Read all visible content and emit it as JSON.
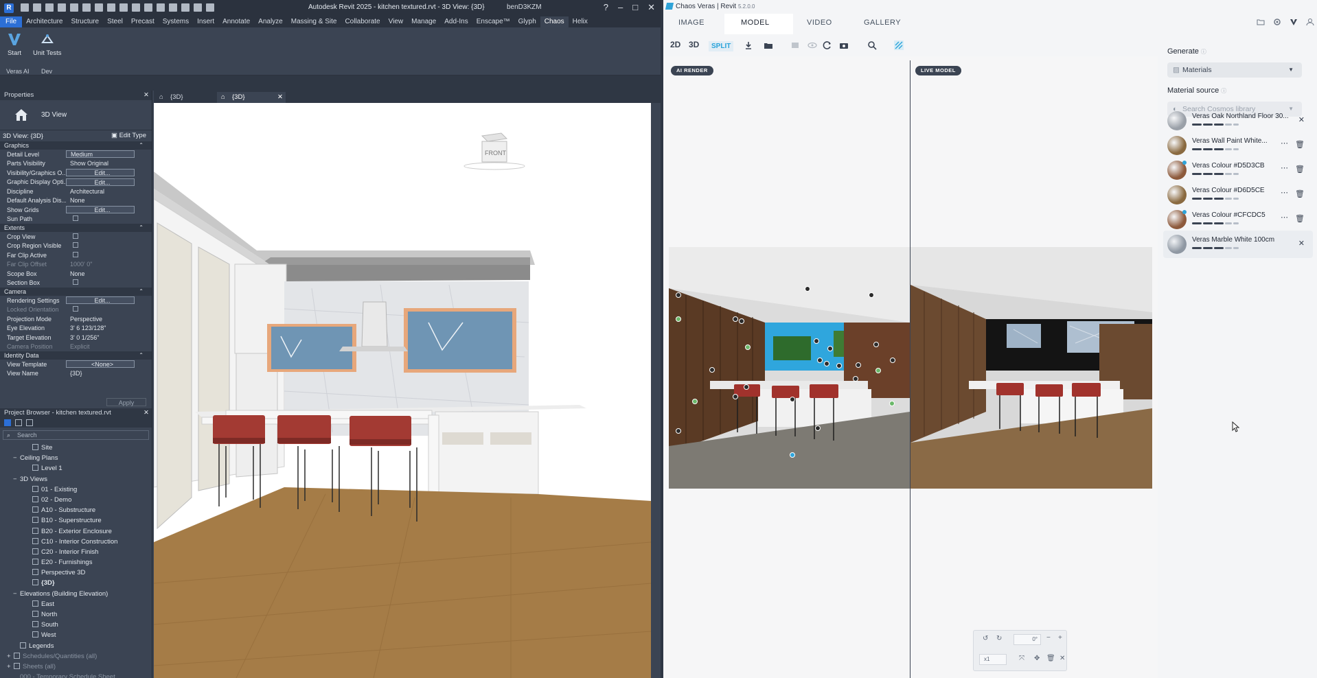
{
  "revit": {
    "window_title": "Autodesk Revit 2025 - kitchen textured.rvt - 3D View: {3D}",
    "user": "benD3KZM",
    "app_badge": "R",
    "menu": [
      "File",
      "Architecture",
      "Structure",
      "Steel",
      "Precast",
      "Systems",
      "Insert",
      "Annotate",
      "Analyze",
      "Massing & Site",
      "Collaborate",
      "View",
      "Manage",
      "Add-Ins",
      "Enscape™",
      "Glyph",
      "Chaos",
      "Helix"
    ],
    "active_menu": "Chaos",
    "ribbon": {
      "start_label": "Start",
      "unit_tests_label": "Unit Tests",
      "panel_veras": "Veras AI",
      "panel_dev": "Dev"
    },
    "properties": {
      "header": "Properties",
      "type_name": "3D View",
      "view_selector": "3D View: {3D}",
      "edit_type": "Edit Type",
      "sections": [
        {
          "title": "Graphics",
          "rows": [
            {
              "k": "Detail Level",
              "v": "Medium",
              "t": "box"
            },
            {
              "k": "Parts Visibility",
              "v": "Show Original",
              "t": "text"
            },
            {
              "k": "Visibility/Graphics O...",
              "v": "Edit...",
              "t": "btn"
            },
            {
              "k": "Graphic Display Opti...",
              "v": "Edit...",
              "t": "btn"
            },
            {
              "k": "Discipline",
              "v": "Architectural",
              "t": "text"
            },
            {
              "k": "Default Analysis Dis...",
              "v": "None",
              "t": "text"
            },
            {
              "k": "Show Grids",
              "v": "Edit...",
              "t": "btn"
            },
            {
              "k": "Sun Path",
              "v": "",
              "t": "chk"
            }
          ]
        },
        {
          "title": "Extents",
          "rows": [
            {
              "k": "Crop View",
              "v": "",
              "t": "chk"
            },
            {
              "k": "Crop Region Visible",
              "v": "",
              "t": "chk"
            },
            {
              "k": "Far Clip Active",
              "v": "",
              "t": "chk"
            },
            {
              "k": "Far Clip Offset",
              "v": "1000'  0\"",
              "t": "dim"
            },
            {
              "k": "Scope Box",
              "v": "None",
              "t": "text"
            },
            {
              "k": "Section Box",
              "v": "",
              "t": "chk"
            }
          ]
        },
        {
          "title": "Camera",
          "rows": [
            {
              "k": "Rendering Settings",
              "v": "Edit...",
              "t": "btn"
            },
            {
              "k": "Locked Orientation",
              "v": "",
              "t": "dimchk"
            },
            {
              "k": "Projection Mode",
              "v": "Perspective",
              "t": "text"
            },
            {
              "k": "Eye Elevation",
              "v": "3'  6 123/128\"",
              "t": "text"
            },
            {
              "k": "Target Elevation",
              "v": "3'  0 1/256\"",
              "t": "text"
            },
            {
              "k": "Camera Position",
              "v": "Explicit",
              "t": "dim"
            }
          ]
        },
        {
          "title": "Identity Data",
          "rows": [
            {
              "k": "View Template",
              "v": "<None>",
              "t": "btn"
            },
            {
              "k": "View Name",
              "v": "{3D}",
              "t": "text"
            }
          ]
        }
      ],
      "apply": "Apply"
    },
    "browser": {
      "header": "Project Browser - kitchen textured.rvt",
      "search_placeholder": "Search",
      "items": [
        {
          "label": "Site",
          "indent": 3,
          "icon": true,
          "toggle": ""
        },
        {
          "label": "Ceiling Plans",
          "indent": 1,
          "icon": false,
          "toggle": "−"
        },
        {
          "label": "Level 1",
          "indent": 3,
          "icon": true,
          "toggle": ""
        },
        {
          "label": "3D Views",
          "indent": 1,
          "icon": false,
          "toggle": "−"
        },
        {
          "label": "01 - Existing",
          "indent": 3,
          "icon": true,
          "toggle": ""
        },
        {
          "label": "02 - Demo",
          "indent": 3,
          "icon": true,
          "toggle": ""
        },
        {
          "label": "A10 - Substructure",
          "indent": 3,
          "icon": true,
          "toggle": ""
        },
        {
          "label": "B10 - Superstructure",
          "indent": 3,
          "icon": true,
          "toggle": ""
        },
        {
          "label": "B20 - Exterior Enclosure",
          "indent": 3,
          "icon": true,
          "toggle": ""
        },
        {
          "label": "C10 - Interior Construction",
          "indent": 3,
          "icon": true,
          "toggle": ""
        },
        {
          "label": "C20 - Interior Finish",
          "indent": 3,
          "icon": true,
          "toggle": ""
        },
        {
          "label": "E20 - Furnishings",
          "indent": 3,
          "icon": true,
          "toggle": ""
        },
        {
          "label": "Perspective 3D",
          "indent": 3,
          "icon": true,
          "toggle": ""
        },
        {
          "label": "{3D}",
          "indent": 3,
          "icon": true,
          "toggle": "",
          "bold": true
        },
        {
          "label": "Elevations (Building Elevation)",
          "indent": 1,
          "icon": false,
          "toggle": "−"
        },
        {
          "label": "East",
          "indent": 3,
          "icon": true,
          "toggle": ""
        },
        {
          "label": "North",
          "indent": 3,
          "icon": true,
          "toggle": ""
        },
        {
          "label": "South",
          "indent": 3,
          "icon": true,
          "toggle": ""
        },
        {
          "label": "West",
          "indent": 3,
          "icon": true,
          "toggle": ""
        },
        {
          "label": "Legends",
          "indent": 1,
          "icon": true,
          "toggle": ""
        },
        {
          "label": "Schedules/Quantities (all)",
          "indent": 0,
          "icon": true,
          "toggle": "+",
          "dim": true
        },
        {
          "label": "Sheets (all)",
          "indent": 0,
          "icon": true,
          "toggle": "+",
          "dim": true
        },
        {
          "label": "000 - Temporary Schedule Sheet",
          "indent": 1,
          "icon": false,
          "toggle": "",
          "dim": true
        }
      ]
    },
    "view_tabs": [
      "{3D}",
      "{3D}"
    ],
    "viewcube_label": "FRONT"
  },
  "veras": {
    "window_title": "Chaos Veras | Revit",
    "version": "5.2.0.0",
    "tabs": [
      "IMAGE",
      "MODEL",
      "VIDEO",
      "GALLERY"
    ],
    "active_tab": "MODEL",
    "toolbar": {
      "btn_2d": "2D",
      "btn_3d": "3D",
      "btn_split": "SPLIT"
    },
    "badge_ai": "AI RENDER",
    "badge_live": "LIVE MODEL",
    "controls": {
      "angle": "0°",
      "scale": "x1"
    },
    "side": {
      "generate_label": "Generate",
      "generate_value": "Materials",
      "source_label": "Material source",
      "source_placeholder": "Search Cosmos library",
      "materials": [
        {
          "name": "Veras Oak Northland Floor 30...",
          "color": "#9aa0a8",
          "action": "✕",
          "selected": false
        },
        {
          "name": "Veras Wall Paint White...",
          "color": "#8a6a40",
          "action": "🗑",
          "selected": false
        },
        {
          "name": "Veras Colour #D5D3CB",
          "color": "#8d5a3c",
          "action": "🗑",
          "selected": false
        },
        {
          "name": "Veras Colour #D6D5CE",
          "color": "#8a6a40",
          "action": "🗑",
          "selected": false
        },
        {
          "name": "Veras Colour #CFCDC5",
          "color": "#8d5a3c",
          "action": "🗑",
          "selected": false
        },
        {
          "name": "Veras Marble White 100cm",
          "color": "#8f98a3",
          "action": "✕",
          "selected": true
        }
      ]
    }
  }
}
